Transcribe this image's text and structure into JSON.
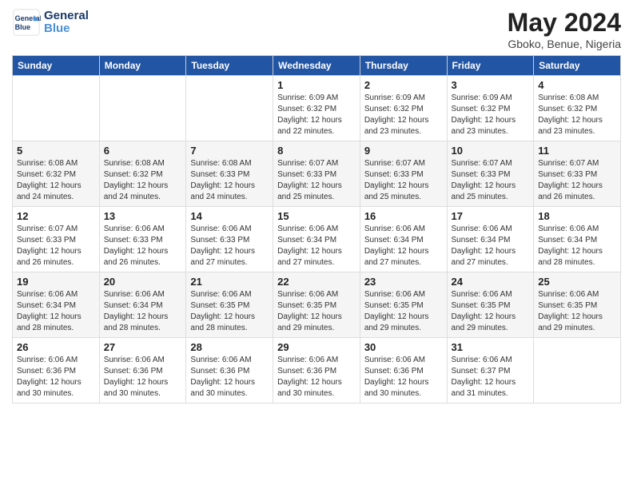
{
  "logo": {
    "line1": "General",
    "line2": "Blue"
  },
  "title": "May 2024",
  "location": "Gboko, Benue, Nigeria",
  "days_header": [
    "Sunday",
    "Monday",
    "Tuesday",
    "Wednesday",
    "Thursday",
    "Friday",
    "Saturday"
  ],
  "weeks": [
    [
      {
        "day": "",
        "info": ""
      },
      {
        "day": "",
        "info": ""
      },
      {
        "day": "",
        "info": ""
      },
      {
        "day": "1",
        "sunrise": "6:09 AM",
        "sunset": "6:32 PM",
        "daylight": "12 hours and 22 minutes."
      },
      {
        "day": "2",
        "sunrise": "6:09 AM",
        "sunset": "6:32 PM",
        "daylight": "12 hours and 23 minutes."
      },
      {
        "day": "3",
        "sunrise": "6:09 AM",
        "sunset": "6:32 PM",
        "daylight": "12 hours and 23 minutes."
      },
      {
        "day": "4",
        "sunrise": "6:08 AM",
        "sunset": "6:32 PM",
        "daylight": "12 hours and 23 minutes."
      }
    ],
    [
      {
        "day": "5",
        "sunrise": "6:08 AM",
        "sunset": "6:32 PM",
        "daylight": "12 hours and 24 minutes."
      },
      {
        "day": "6",
        "sunrise": "6:08 AM",
        "sunset": "6:32 PM",
        "daylight": "12 hours and 24 minutes."
      },
      {
        "day": "7",
        "sunrise": "6:08 AM",
        "sunset": "6:33 PM",
        "daylight": "12 hours and 24 minutes."
      },
      {
        "day": "8",
        "sunrise": "6:07 AM",
        "sunset": "6:33 PM",
        "daylight": "12 hours and 25 minutes."
      },
      {
        "day": "9",
        "sunrise": "6:07 AM",
        "sunset": "6:33 PM",
        "daylight": "12 hours and 25 minutes."
      },
      {
        "day": "10",
        "sunrise": "6:07 AM",
        "sunset": "6:33 PM",
        "daylight": "12 hours and 25 minutes."
      },
      {
        "day": "11",
        "sunrise": "6:07 AM",
        "sunset": "6:33 PM",
        "daylight": "12 hours and 26 minutes."
      }
    ],
    [
      {
        "day": "12",
        "sunrise": "6:07 AM",
        "sunset": "6:33 PM",
        "daylight": "12 hours and 26 minutes."
      },
      {
        "day": "13",
        "sunrise": "6:06 AM",
        "sunset": "6:33 PM",
        "daylight": "12 hours and 26 minutes."
      },
      {
        "day": "14",
        "sunrise": "6:06 AM",
        "sunset": "6:33 PM",
        "daylight": "12 hours and 27 minutes."
      },
      {
        "day": "15",
        "sunrise": "6:06 AM",
        "sunset": "6:34 PM",
        "daylight": "12 hours and 27 minutes."
      },
      {
        "day": "16",
        "sunrise": "6:06 AM",
        "sunset": "6:34 PM",
        "daylight": "12 hours and 27 minutes."
      },
      {
        "day": "17",
        "sunrise": "6:06 AM",
        "sunset": "6:34 PM",
        "daylight": "12 hours and 27 minutes."
      },
      {
        "day": "18",
        "sunrise": "6:06 AM",
        "sunset": "6:34 PM",
        "daylight": "12 hours and 28 minutes."
      }
    ],
    [
      {
        "day": "19",
        "sunrise": "6:06 AM",
        "sunset": "6:34 PM",
        "daylight": "12 hours and 28 minutes."
      },
      {
        "day": "20",
        "sunrise": "6:06 AM",
        "sunset": "6:34 PM",
        "daylight": "12 hours and 28 minutes."
      },
      {
        "day": "21",
        "sunrise": "6:06 AM",
        "sunset": "6:35 PM",
        "daylight": "12 hours and 28 minutes."
      },
      {
        "day": "22",
        "sunrise": "6:06 AM",
        "sunset": "6:35 PM",
        "daylight": "12 hours and 29 minutes."
      },
      {
        "day": "23",
        "sunrise": "6:06 AM",
        "sunset": "6:35 PM",
        "daylight": "12 hours and 29 minutes."
      },
      {
        "day": "24",
        "sunrise": "6:06 AM",
        "sunset": "6:35 PM",
        "daylight": "12 hours and 29 minutes."
      },
      {
        "day": "25",
        "sunrise": "6:06 AM",
        "sunset": "6:35 PM",
        "daylight": "12 hours and 29 minutes."
      }
    ],
    [
      {
        "day": "26",
        "sunrise": "6:06 AM",
        "sunset": "6:36 PM",
        "daylight": "12 hours and 30 minutes."
      },
      {
        "day": "27",
        "sunrise": "6:06 AM",
        "sunset": "6:36 PM",
        "daylight": "12 hours and 30 minutes."
      },
      {
        "day": "28",
        "sunrise": "6:06 AM",
        "sunset": "6:36 PM",
        "daylight": "12 hours and 30 minutes."
      },
      {
        "day": "29",
        "sunrise": "6:06 AM",
        "sunset": "6:36 PM",
        "daylight": "12 hours and 30 minutes."
      },
      {
        "day": "30",
        "sunrise": "6:06 AM",
        "sunset": "6:36 PM",
        "daylight": "12 hours and 30 minutes."
      },
      {
        "day": "31",
        "sunrise": "6:06 AM",
        "sunset": "6:37 PM",
        "daylight": "12 hours and 31 minutes."
      },
      {
        "day": "",
        "info": ""
      }
    ]
  ]
}
